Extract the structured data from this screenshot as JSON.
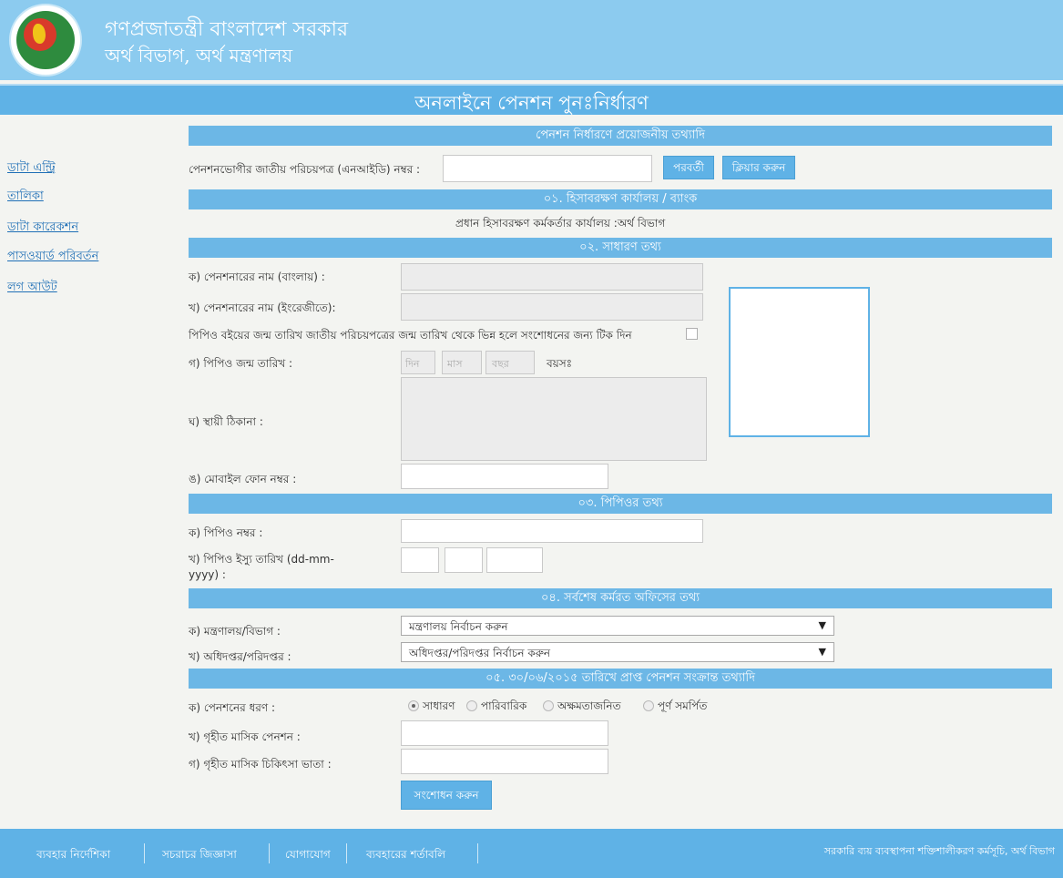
{
  "header": {
    "title_line1": "গণপ্রজাতন্ত্রী বাংলাদেশ সরকার",
    "title_line2": "অর্থ বিভাগ, অর্থ মন্ত্রণালয়",
    "logo_icon": "govt-seal-icon"
  },
  "banner": {
    "title": "অনলাইনে পেনশন পুনঃনির্ধারণ"
  },
  "sidebar": {
    "items": [
      {
        "label": "ডাটা এন্ট্রি"
      },
      {
        "label": "তালিকা"
      },
      {
        "label": "ডাটা কারেকশন"
      },
      {
        "label": "পাসওয়ার্ড পরিবর্তন"
      },
      {
        "label": "লগ আউট"
      }
    ]
  },
  "search": {
    "section_title": "পেনশন নির্ধারণে প্রয়োজনীয় তথ্যাদি",
    "nid_label": "পেনশনভোগীর জাতীয় পরিচয়পত্র (এনআইডি) নম্বর :",
    "nid_value": "",
    "next_button": "পরবর্তী",
    "clear_button": "ক্লিয়ার করুন"
  },
  "section1": {
    "title": "০১. হিসাবরক্ষণ কার্যালয় / ব্যাংক",
    "office_text": "প্রধান হিসাবরক্ষণ কর্মকর্তার কার্যালয় :অর্থ বিভাগ"
  },
  "section2": {
    "title": "০২. সাধারণ তথ্য",
    "name_bn_label": "ক) পেনশনারের নাম (বাংলায়) :",
    "name_en_label": "খ) পেনশনারের নাম (ইংরেজীতে):",
    "dob_mismatch_text": "পিপিও বইয়ের জন্ম তারিখ জাতীয় পরিচয়পত্রের জন্ম তারিখ থেকে ভিন্ন হলে সংশোধনের জন্য টিক দিন",
    "dob_label": "গ) পিপিও জন্ম তারিখ :",
    "day_placeholder": "দিন",
    "month_placeholder": "মাস",
    "year_placeholder": "বছর",
    "age_label": "বয়সঃ",
    "address_label": "ঘ) স্থায়ী ঠিকানা :",
    "mobile_label": "ঙ) মোবাইল ফোন নম্বর :"
  },
  "section3": {
    "title": "০৩. পিপিওর তথ্য",
    "ppo_no_label": "ক) পিপিও নম্বর :",
    "ppo_issue_label_1": "খ) পিপিও ইস্যু তারিখ (dd-mm-",
    "ppo_issue_label_2": "yyyy) :"
  },
  "section4": {
    "title": "০৪. সর্বশেষ কর্মরত অফিসের তথ্য",
    "ministry_label": "ক) মন্ত্রণালয়/বিভাগ :",
    "ministry_selected": "মন্ত্রণালয় নির্বাচন করুন",
    "directorate_label": "খ) অধিদপ্তর/পরিদপ্তর :",
    "directorate_selected": "অধিদপ্তর/পরিদপ্তর নির্বাচন করুন"
  },
  "section5": {
    "title": "০৫. ৩০/০৬/২০১৫ তারিখে প্রাপ্ত পেনশন সংক্রান্ত তথ্যাদি",
    "type_label": "ক) পেনশনের ধরণ :",
    "options": [
      "সাধারণ",
      "পারিবারিক",
      "অক্ষমতাজনিত",
      "পূর্ণ সমর্পিত"
    ],
    "selected_option": "সাধারণ",
    "monthly_pension_label": "খ) গৃহীত মাসিক পেনশন :",
    "medical_allowance_label": "গ) গৃহীত মাসিক চিকিৎসা ভাতা :",
    "submit_button": "সংশোধন করুন"
  },
  "footer": {
    "links": [
      "ব্যবহার নির্দেশিকা",
      "সচরাচর জিজ্ঞাসা",
      "যোগাযোগ",
      "ব্যবহারের শর্তাবলি"
    ],
    "credit": "সরকারি ব্যয় ব্যবস্থাপনা শক্তিশালীকরণ কর্মসূচি, অর্থ বিভাগ"
  }
}
